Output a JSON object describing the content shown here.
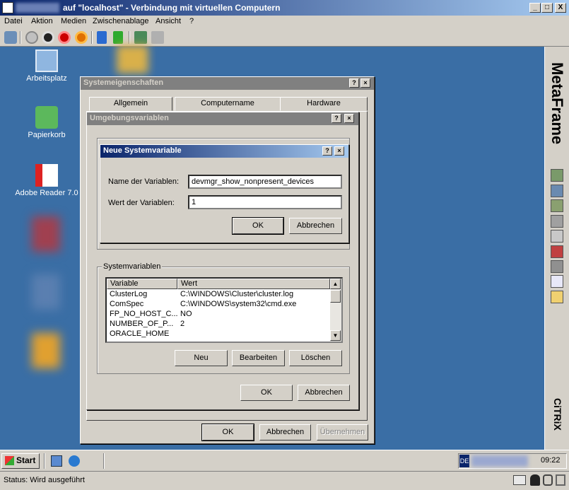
{
  "window": {
    "title": "auf \"localhost\" - Verbindung mit virtuellen Computern",
    "controls": {
      "minimize": "_",
      "maximize": "□",
      "close": "X"
    }
  },
  "menu": [
    "Datei",
    "Aktion",
    "Medien",
    "Zwischenablage",
    "Ansicht",
    "?"
  ],
  "desktop_icons": [
    {
      "label": "Arbeitsplatz",
      "icon": "computer-icon"
    },
    {
      "label": "Papierkorb",
      "icon": "recycle-bin-icon"
    },
    {
      "label": "Adobe Reader 7.0",
      "icon": "adobe-reader-icon"
    }
  ],
  "side_panel": {
    "brand_top": "MetaFrame",
    "brand_bottom": "CiTRiX"
  },
  "sys_props": {
    "title": "Systemeigenschaften",
    "tabs": [
      "Allgemein",
      "Computername",
      "Hardware"
    ],
    "ok": "OK",
    "cancel": "Abbrechen",
    "apply": "Übernehmen"
  },
  "env_vars": {
    "title": "Umgebungsvariablen",
    "group_label": "Systemvariablen",
    "columns": [
      "Variable",
      "Wert"
    ],
    "rows": [
      [
        "ClusterLog",
        "C:\\WINDOWS\\Cluster\\cluster.log"
      ],
      [
        "ComSpec",
        "C:\\WINDOWS\\system32\\cmd.exe"
      ],
      [
        "FP_NO_HOST_C...",
        "NO"
      ],
      [
        "NUMBER_OF_P...",
        "2"
      ],
      [
        "ORACLE_HOME",
        ""
      ]
    ],
    "new": "Neu",
    "edit": "Bearbeiten",
    "delete": "Löschen",
    "ok": "OK",
    "cancel": "Abbrechen"
  },
  "new_var": {
    "title": "Neue Systemvariable",
    "name_label": "Name der Variablen:",
    "name_value": "devmgr_show_nonpresent_devices",
    "value_label": "Wert der Variablen:",
    "value_value": "1",
    "ok": "OK",
    "cancel": "Abbrechen"
  },
  "taskbar": {
    "start": "Start",
    "tray_prefix": "DE",
    "clock": "09:22"
  },
  "status": {
    "text": "Status: Wird ausgeführt"
  },
  "colors": {
    "desktop": "#3a6ea5",
    "title_active": "#0a246a",
    "title_inactive": "#808080",
    "face": "#d4d0c8"
  }
}
